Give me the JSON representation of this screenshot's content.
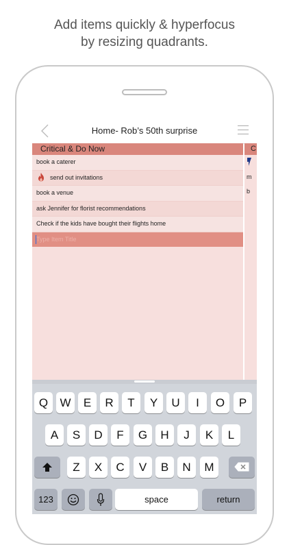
{
  "headline": {
    "line1": "Add items quickly & hyperfocus",
    "line2": "by resizing quadrants."
  },
  "navbar": {
    "title": "Home- Rob’s 50th surprise",
    "back_icon": "chevron-left-icon",
    "menu_icon": "hamburger-menu-icon"
  },
  "quadrant": {
    "title": "Critical & Do Now",
    "color": "#d9867c",
    "items": [
      {
        "label": "book a caterer"
      },
      {
        "label": "send out invitations",
        "icon": "flame-icon"
      },
      {
        "label": "book a venue"
      },
      {
        "label": "ask Jennifer for florist recommendations"
      },
      {
        "label": "Check if the kids have bought their flights home"
      }
    ],
    "new_item_placeholder": "Type Item Title"
  },
  "quadrant2": {
    "title_partial": "C",
    "items": [
      {
        "label": ""
      },
      {
        "label": "m"
      },
      {
        "label": "b"
      }
    ]
  },
  "keyboard": {
    "row1": [
      "Q",
      "W",
      "E",
      "R",
      "T",
      "Y",
      "U",
      "I",
      "O",
      "P"
    ],
    "row2": [
      "A",
      "S",
      "D",
      "F",
      "G",
      "H",
      "J",
      "K",
      "L"
    ],
    "row3": [
      "Z",
      "X",
      "C",
      "V",
      "B",
      "N",
      "M"
    ],
    "numbers_label": "123",
    "space_label": "space",
    "return_label": "return",
    "shift_icon": "shift-icon",
    "delete_icon": "delete-icon",
    "emoji_icon": "emoji-icon",
    "mic_icon": "microphone-icon"
  }
}
